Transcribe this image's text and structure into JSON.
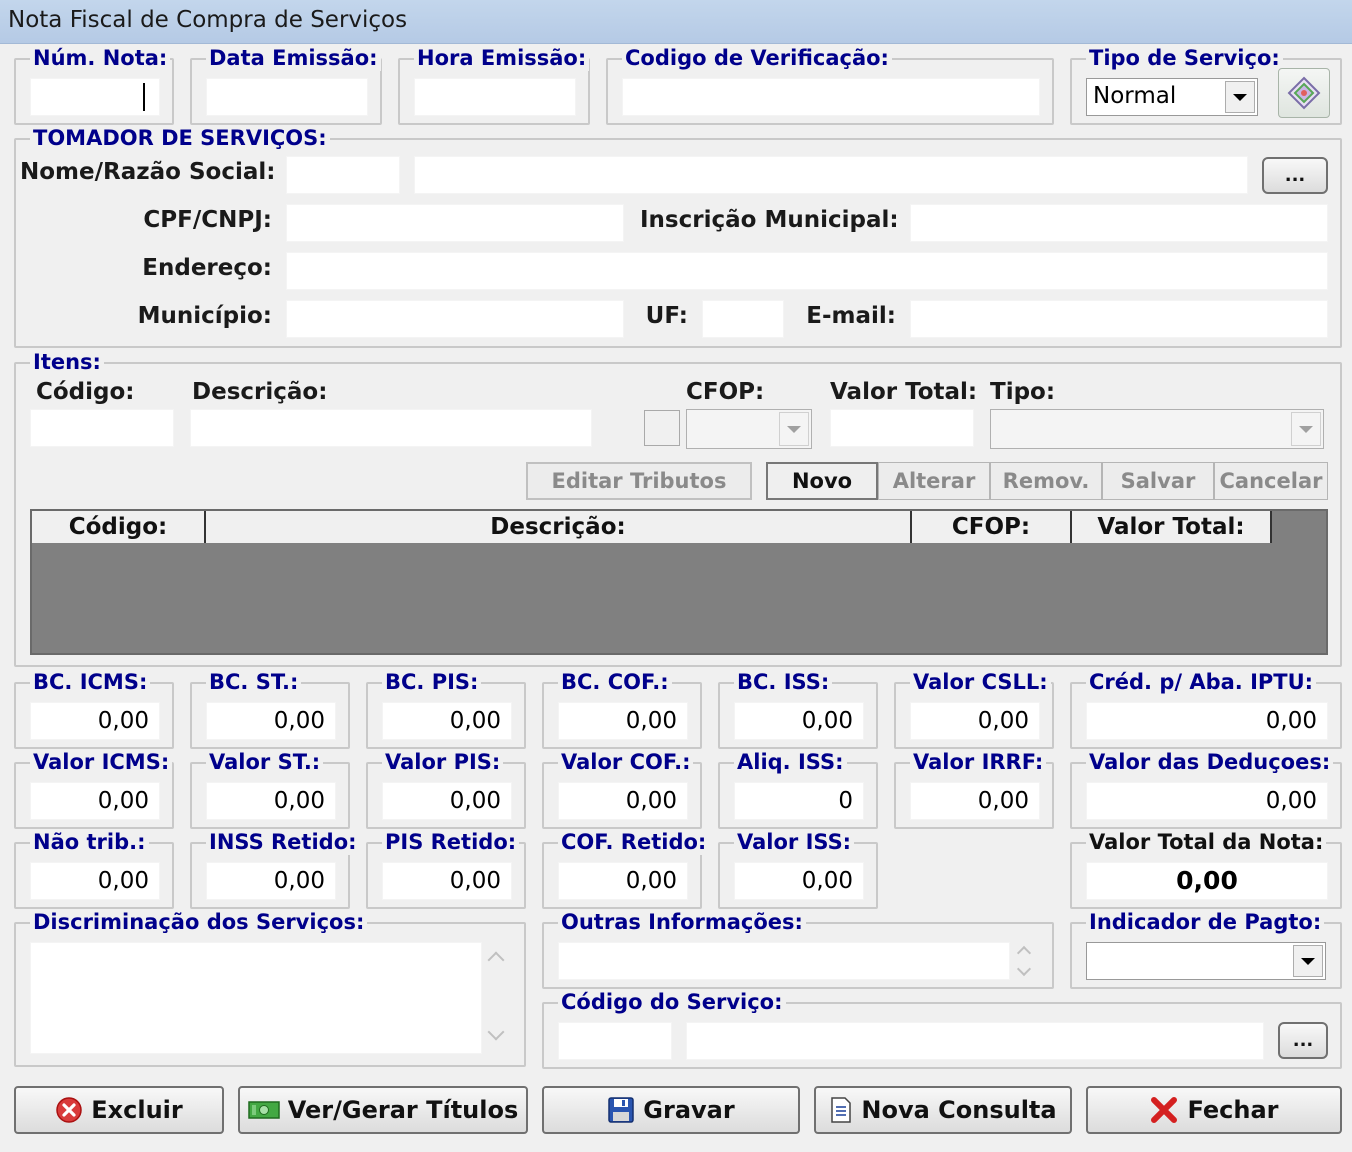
{
  "window": {
    "title": "Nota Fiscal de Compra de Serviços"
  },
  "header": {
    "num_nota_label": "Núm. Nota:",
    "data_emissao_label": "Data Emissão:",
    "hora_emissao_label": "Hora Emissão:",
    "codigo_verificacao_label": "Codigo de Verificação:",
    "tipo_servico_label": "Tipo de Serviço:",
    "tipo_servico_value": "Normal"
  },
  "tomador": {
    "section_label": "TOMADOR DE SERVIÇOS:",
    "nome_label": "Nome/Razão Social:",
    "lookup_button": "...",
    "cpf_label": "CPF/CNPJ:",
    "inscricao_label": "Inscrição Municipal:",
    "endereco_label": "Endereço:",
    "municipio_label": "Município:",
    "uf_label": "UF:",
    "email_label": "E-mail:"
  },
  "itens": {
    "section_label": "Itens:",
    "codigo_label": "Código:",
    "descricao_label": "Descrição:",
    "cfop_label": "CFOP:",
    "valor_total_label": "Valor Total:",
    "tipo_label": "Tipo:",
    "buttons": {
      "editar_tributos": "Editar Tributos",
      "novo": "Novo",
      "alterar": "Alterar",
      "remov": "Remov.",
      "salvar": "Salvar",
      "cancelar": "Cancelar"
    },
    "grid_columns": [
      "Código:",
      "Descrição:",
      "CFOP:",
      "Valor Total:"
    ]
  },
  "totais": {
    "bc_icms": {
      "label": "BC. ICMS:",
      "value": "0,00"
    },
    "bc_st": {
      "label": "BC. ST.:",
      "value": "0,00"
    },
    "bc_pis": {
      "label": "BC. PIS:",
      "value": "0,00"
    },
    "bc_cof": {
      "label": "BC. COF.:",
      "value": "0,00"
    },
    "bc_iss": {
      "label": "BC. ISS:",
      "value": "0,00"
    },
    "valor_csll": {
      "label": "Valor CSLL:",
      "value": "0,00"
    },
    "cred_iptu": {
      "label": "Créd. p/ Aba. IPTU:",
      "value": "0,00"
    },
    "valor_icms": {
      "label": "Valor ICMS:",
      "value": "0,00"
    },
    "valor_st": {
      "label": "Valor ST.:",
      "value": "0,00"
    },
    "valor_pis": {
      "label": "Valor PIS:",
      "value": "0,00"
    },
    "valor_cof": {
      "label": "Valor COF.:",
      "value": "0,00"
    },
    "aliq_iss": {
      "label": "Aliq. ISS:",
      "value": "0"
    },
    "valor_irrf": {
      "label": "Valor IRRF:",
      "value": "0,00"
    },
    "valor_deducoes": {
      "label": "Valor das Deduçoes:",
      "value": "0,00"
    },
    "nao_trib": {
      "label": "Não trib.:",
      "value": "0,00"
    },
    "inss_retido": {
      "label": "INSS Retido:",
      "value": "0,00"
    },
    "pis_retido": {
      "label": "PIS Retido:",
      "value": "0,00"
    },
    "cof_retido": {
      "label": "COF. Retido:",
      "value": "0,00"
    },
    "valor_iss": {
      "label": "Valor ISS:",
      "value": "0,00"
    },
    "valor_total_nota": {
      "label": "Valor Total da Nota:",
      "value": "0,00"
    }
  },
  "discriminacao_label": "Discriminação dos Serviços:",
  "outras_info_label": "Outras Informações:",
  "indicador_pagto_label": "Indicador de Pagto:",
  "codigo_servico": {
    "label": "Código do Serviço:",
    "lookup_button": "..."
  },
  "footer": {
    "excluir": "Excluir",
    "ver_gerar_titulos": "Ver/Gerar Títulos",
    "gravar": "Gravar",
    "nova_consulta": "Nova Consulta",
    "fechar": "Fechar"
  },
  "colors": {
    "legend": "#00008b",
    "titlebar": "#b9cde7",
    "grid_bg": "#808080"
  }
}
